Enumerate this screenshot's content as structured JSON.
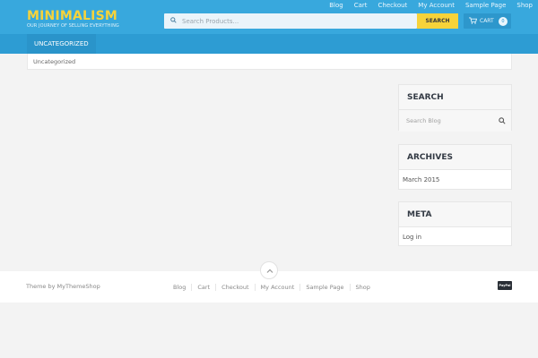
{
  "site": {
    "title": "MINIMALISM",
    "tagline": "OUR JOURNEY OF SELLING EVERYTHING"
  },
  "topnav": [
    "Blog",
    "Cart",
    "Checkout",
    "My Account",
    "Sample Page",
    "Shop"
  ],
  "product_search": {
    "placeholder": "Search Products...",
    "button_label": "SEARCH"
  },
  "cart": {
    "label": "CART",
    "count": "0"
  },
  "catbar": {
    "active_category": "UNCATEGORIZED"
  },
  "breadcrumb": {
    "text": "Uncategorized"
  },
  "sidebar": {
    "search": {
      "title": "SEARCH",
      "placeholder": "Search Blog"
    },
    "archives": {
      "title": "ARCHIVES",
      "items": [
        "March 2015"
      ]
    },
    "meta": {
      "title": "META",
      "items": [
        "Log in"
      ]
    }
  },
  "footer": {
    "credit": "Theme by MyThemeShop",
    "nav": [
      "Blog",
      "Cart",
      "Checkout",
      "My Account",
      "Sample Page",
      "Shop"
    ],
    "payment_badge": "PayPal"
  },
  "colors": {
    "header_blue": "#38a8dd",
    "catbar_blue": "#2d9cd3",
    "accent_yellow": "#f6d33a",
    "background": "#f3f3f3"
  }
}
